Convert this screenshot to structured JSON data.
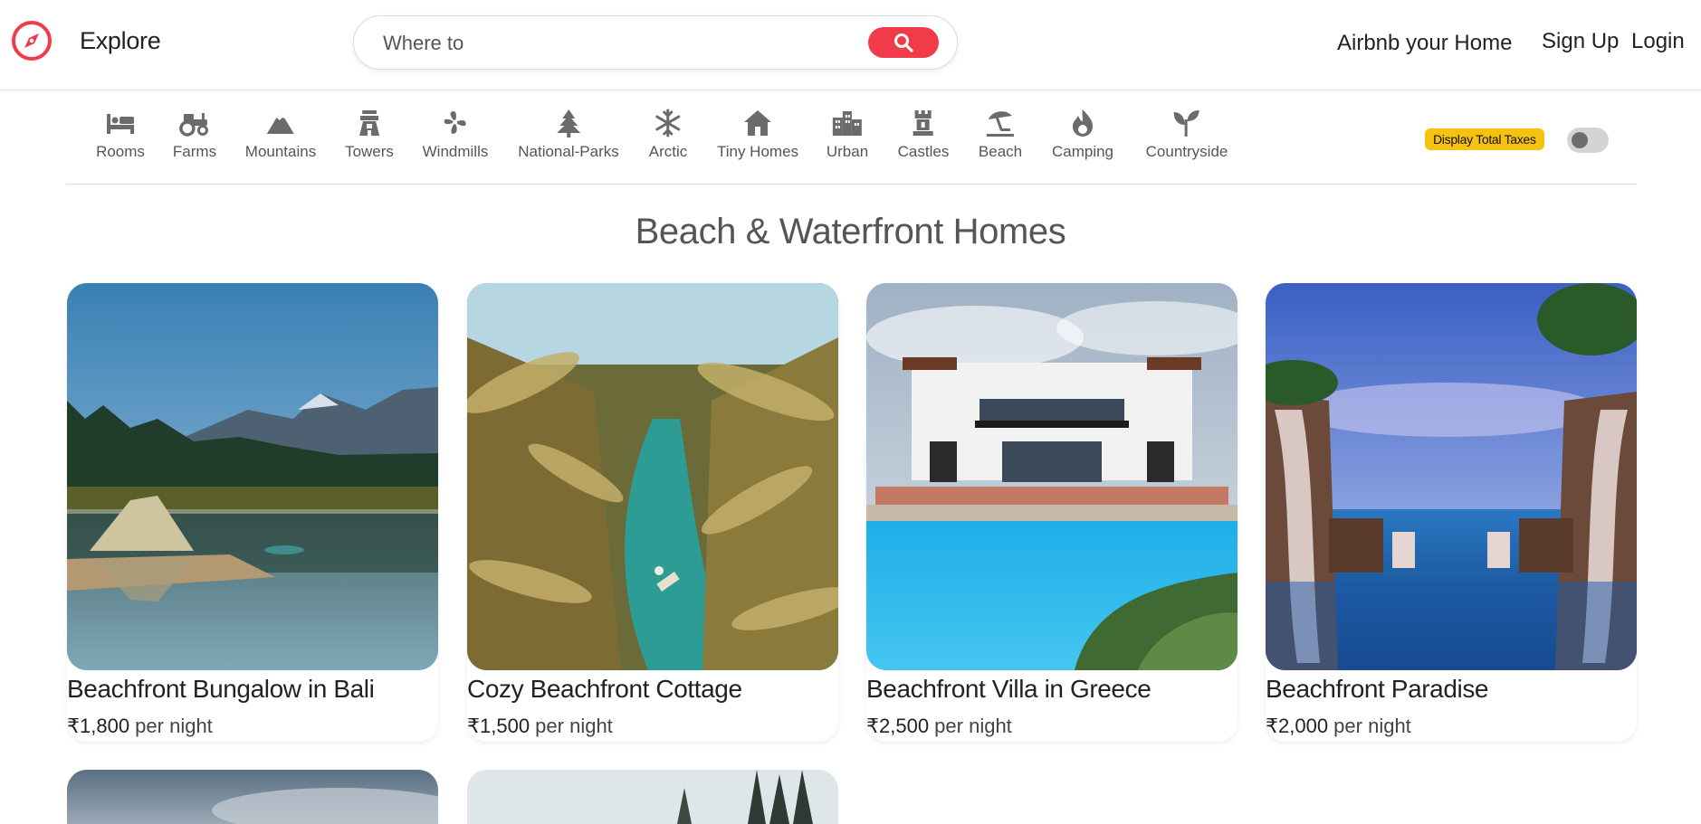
{
  "header": {
    "brand": "Explore",
    "search_placeholder": "Where to",
    "nav": {
      "airbnb_home": "Airbnb your Home",
      "sign_up": "Sign Up",
      "login": "Login"
    }
  },
  "filters": [
    {
      "label": "Rooms",
      "icon": "bed-icon"
    },
    {
      "label": "Farms",
      "icon": "tractor-icon"
    },
    {
      "label": "Mountains",
      "icon": "mountain-icon"
    },
    {
      "label": "Towers",
      "icon": "tower-icon"
    },
    {
      "label": "Windmills",
      "icon": "windmill-icon"
    },
    {
      "label": "National-Parks",
      "icon": "tree-icon"
    },
    {
      "label": "Arctic",
      "icon": "snowflake-icon"
    },
    {
      "label": "Tiny Homes",
      "icon": "house-icon"
    },
    {
      "label": "Urban",
      "icon": "city-icon"
    },
    {
      "label": "Castles",
      "icon": "castle-icon"
    },
    {
      "label": "Beach",
      "icon": "umbrella-beach-icon"
    },
    {
      "label": "Camping",
      "icon": "campfire-icon"
    },
    {
      "label": "Countryside",
      "icon": "seedling-icon"
    }
  ],
  "taxes": {
    "label": "Display Total Taxes",
    "enabled": false
  },
  "section_title": "Beach & Waterfront Homes",
  "currency_symbol": "₹",
  "listings": [
    {
      "title": "Beachfront Bungalow in Bali",
      "price": "1,800",
      "unit": " per night"
    },
    {
      "title": "Cozy Beachfront Cottage",
      "price": "1,500",
      "unit": " per night"
    },
    {
      "title": "Beachfront Villa in Greece",
      "price": "2,500",
      "unit": " per night"
    },
    {
      "title": "Beachfront Paradise",
      "price": "2,000",
      "unit": " per night"
    }
  ],
  "colors": {
    "brand": "#f23b4a",
    "badge": "#f7c20f",
    "text": "#222222",
    "muted": "#555555"
  }
}
